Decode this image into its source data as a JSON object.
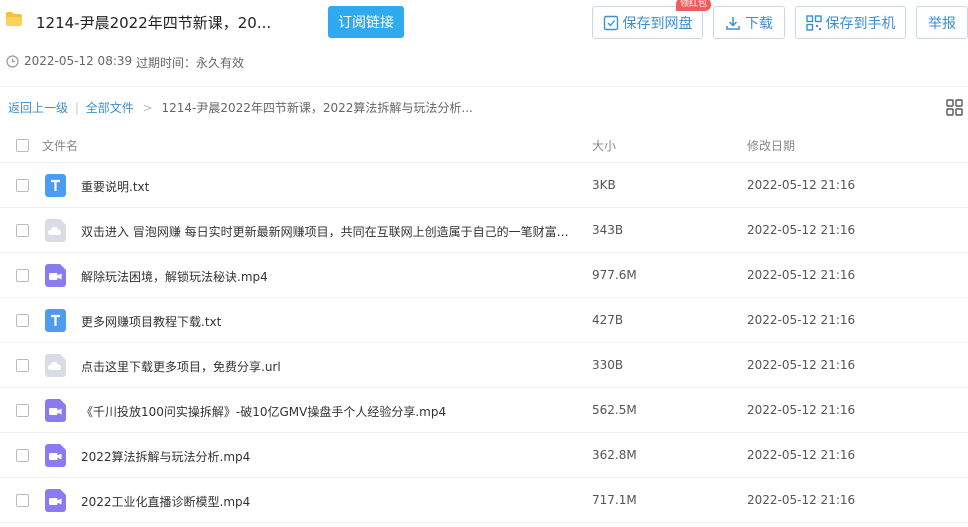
{
  "header": {
    "title": "1214-尹晨2022年四节新课，20...",
    "subscribe_label": "订阅链接",
    "save_label": "保存到网盘",
    "badge_label": "领红包",
    "download_label": "下载",
    "save_phone_label": "保存到手机",
    "report_label": "举报",
    "accent_color": "#2faaf0"
  },
  "meta": {
    "date": "2022-05-12 08:39",
    "expire": "过期时间：永久有效"
  },
  "breadcrumb": {
    "back": "返回上一级",
    "all_files": "全部文件",
    "sep": ">",
    "current": "1214-尹晨2022年四节新课，2022算法拆解与玩法分析..."
  },
  "table": {
    "columns": {
      "name": "文件名",
      "size": "大小",
      "date": "修改日期"
    },
    "rows": [
      {
        "name": "重要说明.txt",
        "size": "3KB",
        "date": "2022-05-12 21:16",
        "icon": "txt-icon"
      },
      {
        "name": "双击进入 冒泡网赚 每日实时更新最新网赚项目，共同在互联网上创造属于自己的一笔财富....",
        "size": "343B",
        "date": "2022-05-12 21:16",
        "icon": "url-icon"
      },
      {
        "name": "解除玩法困境，解锁玩法秘诀.mp4",
        "size": "977.6M",
        "date": "2022-05-12 21:16",
        "icon": "video-icon"
      },
      {
        "name": "更多网赚项目教程下载.txt",
        "size": "427B",
        "date": "2022-05-12 21:16",
        "icon": "txt-icon"
      },
      {
        "name": "点击这里下载更多项目，免费分享.url",
        "size": "330B",
        "date": "2022-05-12 21:16",
        "icon": "url-icon"
      },
      {
        "name": "《千川投放100问实操拆解》-破10亿GMV操盘手个人经验分享.mp4",
        "size": "562.5M",
        "date": "2022-05-12 21:16",
        "icon": "video-icon"
      },
      {
        "name": "2022算法拆解与玩法分析.mp4",
        "size": "362.8M",
        "date": "2022-05-12 21:16",
        "icon": "video-icon"
      },
      {
        "name": "2022工业化直播诊断模型.mp4",
        "size": "717.1M",
        "date": "2022-05-12 21:16",
        "icon": "video-icon"
      }
    ]
  }
}
